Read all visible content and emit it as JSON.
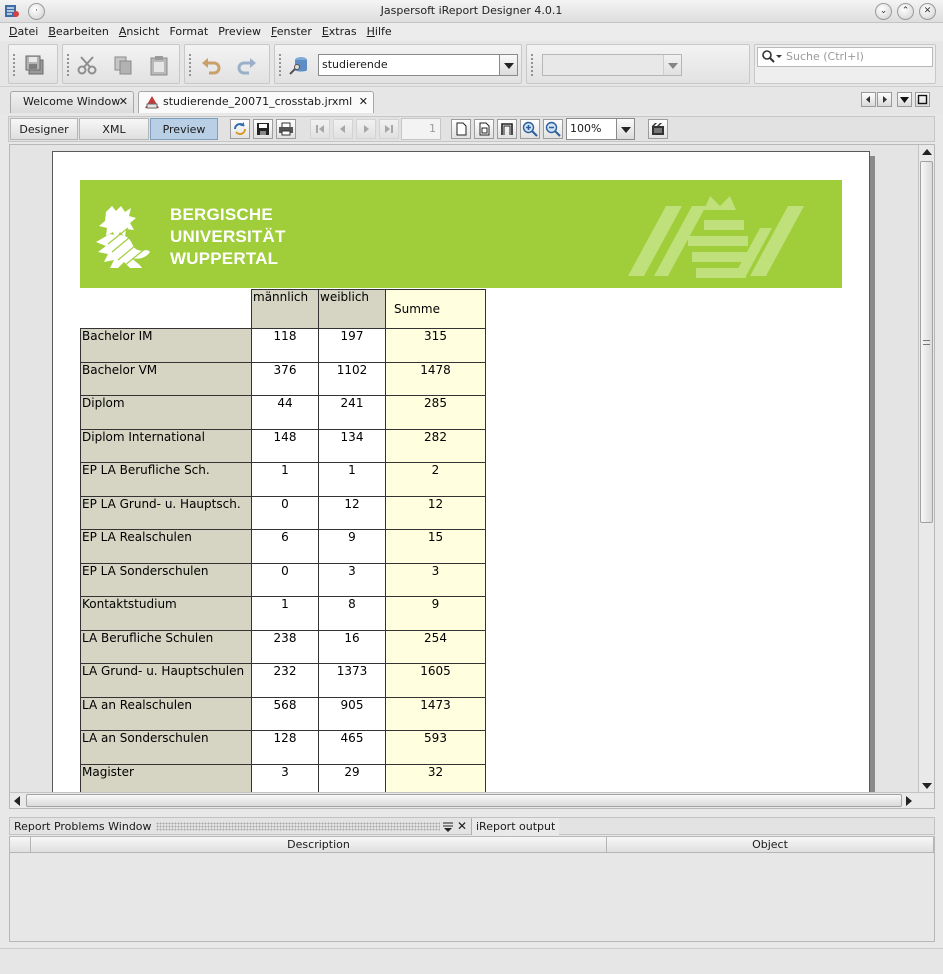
{
  "window": {
    "title": "Jaspersoft iReport Designer 4.0.1"
  },
  "menu": [
    "Datei",
    "Bearbeiten",
    "Ansicht",
    "Format",
    "Preview",
    "Fenster",
    "Extras",
    "Hilfe"
  ],
  "toolbar": {
    "datasource_value": "studierende",
    "second_combo_value": "",
    "search_placeholder": "Suche (Ctrl+I)"
  },
  "tabs": [
    {
      "label": "Welcome Window",
      "active": false
    },
    {
      "label": "studierende_20071_crosstab.jrxml",
      "active": true
    }
  ],
  "view_modes": [
    {
      "label": "Designer",
      "active": false
    },
    {
      "label": "XML",
      "active": false
    },
    {
      "label": "Preview",
      "active": true
    }
  ],
  "preview": {
    "page_number": "1",
    "zoom": "100%"
  },
  "report": {
    "banner_name": [
      "BERGISCHE",
      "UNIVERSITÄT",
      "WUPPERTAL"
    ],
    "columns": [
      "männlich",
      "weiblich",
      "Summe"
    ],
    "rows": [
      {
        "label": "Bachelor IM",
        "m": "118",
        "w": "197",
        "s": "315"
      },
      {
        "label": "Bachelor VM",
        "m": "376",
        "w": "1102",
        "s": "1478"
      },
      {
        "label": "Diplom",
        "m": "44",
        "w": "241",
        "s": "285"
      },
      {
        "label": "Diplom International",
        "m": "148",
        "w": "134",
        "s": "282"
      },
      {
        "label": "EP LA Berufliche Sch.",
        "m": "1",
        "w": "1",
        "s": "2"
      },
      {
        "label": "EP LA Grund- u. Hauptsch.",
        "m": "0",
        "w": "12",
        "s": "12"
      },
      {
        "label": "EP LA Realschulen",
        "m": "6",
        "w": "9",
        "s": "15"
      },
      {
        "label": "EP LA Sonderschulen",
        "m": "0",
        "w": "3",
        "s": "3"
      },
      {
        "label": "Kontaktstudium",
        "m": "1",
        "w": "8",
        "s": "9"
      },
      {
        "label": "LA Berufliche Schulen",
        "m": "238",
        "w": "16",
        "s": "254"
      },
      {
        "label": "LA Grund- u. Hauptschulen",
        "m": "232",
        "w": "1373",
        "s": "1605"
      },
      {
        "label": "LA an Realschulen",
        "m": "568",
        "w": "905",
        "s": "1473"
      },
      {
        "label": "LA an Sonderschulen",
        "m": "128",
        "w": "465",
        "s": "593"
      },
      {
        "label": "Magister",
        "m": "3",
        "w": "29",
        "s": "32"
      }
    ]
  },
  "bottom_panel": {
    "tabs": [
      "Report Problems Window",
      "iReport output"
    ],
    "columns": [
      "Description",
      "Object"
    ]
  },
  "colors": {
    "banner_green": "#9fce3a",
    "header_fill": "#d6d5c3",
    "sum_fill": "#ffffe0",
    "active_mode": "#b8cfe6"
  }
}
